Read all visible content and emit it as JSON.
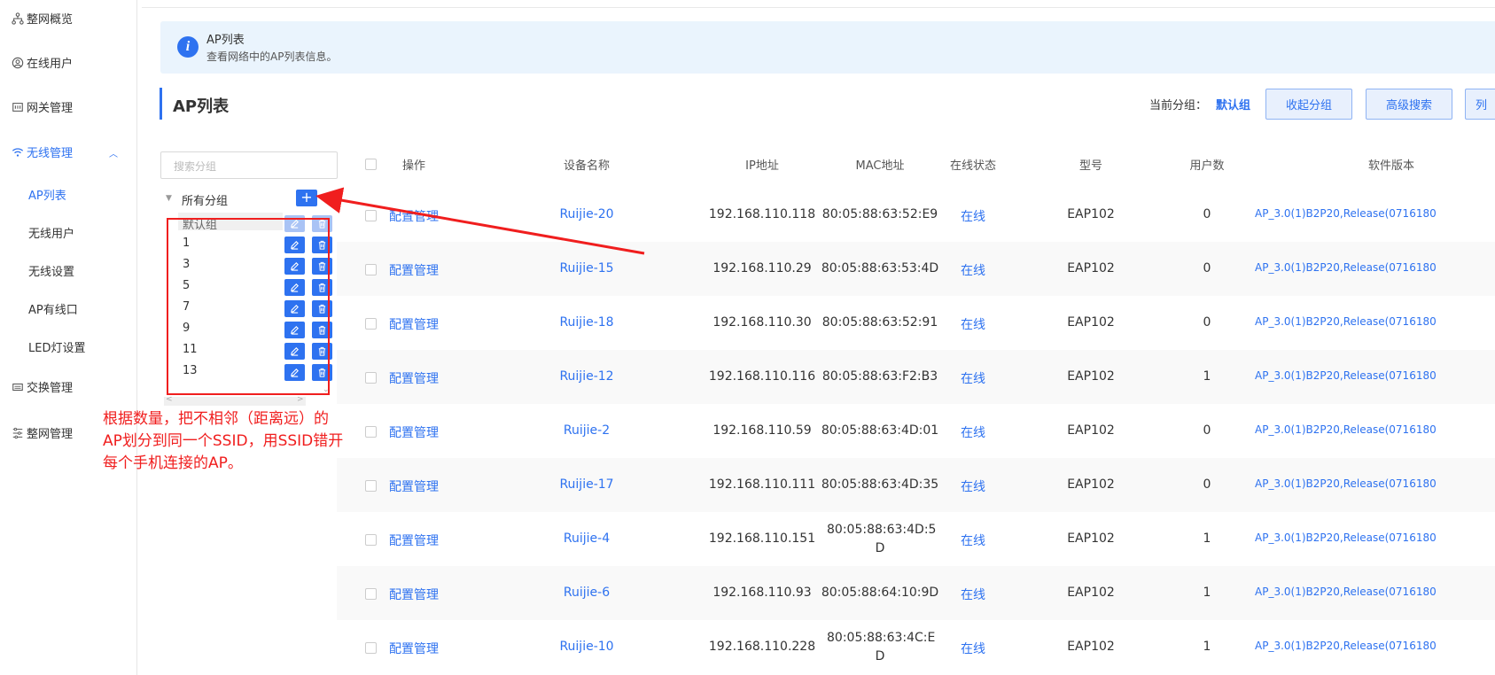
{
  "sidebar": {
    "items": [
      {
        "label": "整网概览",
        "icon": "topology-icon"
      },
      {
        "label": "在线用户",
        "icon": "user-circle-icon"
      },
      {
        "label": "网关管理",
        "icon": "gateway-icon"
      },
      {
        "label": "无线管理",
        "icon": "wifi-icon"
      },
      {
        "label": "交换管理",
        "icon": "switch-icon"
      },
      {
        "label": "整网管理",
        "icon": "network-manage-icon"
      }
    ],
    "wireless_sub": [
      "AP列表",
      "无线用户",
      "无线设置",
      "AP有线口",
      "LED灯设置"
    ]
  },
  "banner": {
    "title": "AP列表",
    "desc": "查看网络中的AP列表信息。"
  },
  "page": {
    "title": "AP列表",
    "current_group_label": "当前分组：",
    "current_group_value": "默认组",
    "btn_collapse": "收起分组",
    "btn_advanced": "高级搜索",
    "btn_columns": "列"
  },
  "groups": {
    "search_placeholder": "搜索分组",
    "root": "所有分组",
    "add": "+",
    "items": [
      "默认组",
      "1",
      "3",
      "5",
      "7",
      "9",
      "11",
      "13"
    ]
  },
  "annotation": {
    "line1": "根据数量，把不相邻（距离远）的",
    "line2": "AP划分到同一个SSID，用SSID错开",
    "line3": "每个手机连接的AP。"
  },
  "table": {
    "headers": {
      "op": "操作",
      "name": "设备名称",
      "ip": "IP地址",
      "mac": "MAC地址",
      "status": "在线状态",
      "model": "型号",
      "users": "用户数",
      "software": "软件版本"
    },
    "rows": [
      {
        "op": "配置管理",
        "name": "Ruijie-20",
        "ip": "192.168.110.118",
        "mac": "80:05:88:63:52:E9",
        "status": "在线",
        "model": "EAP102",
        "users": "0",
        "software": "AP_3.0(1)B2P20,Release(0716180"
      },
      {
        "op": "配置管理",
        "name": "Ruijie-15",
        "ip": "192.168.110.29",
        "mac": "80:05:88:63:53:4D",
        "status": "在线",
        "model": "EAP102",
        "users": "0",
        "software": "AP_3.0(1)B2P20,Release(0716180"
      },
      {
        "op": "配置管理",
        "name": "Ruijie-18",
        "ip": "192.168.110.30",
        "mac": "80:05:88:63:52:91",
        "status": "在线",
        "model": "EAP102",
        "users": "0",
        "software": "AP_3.0(1)B2P20,Release(0716180"
      },
      {
        "op": "配置管理",
        "name": "Ruijie-12",
        "ip": "192.168.110.116",
        "mac": "80:05:88:63:F2:B3",
        "status": "在线",
        "model": "EAP102",
        "users": "1",
        "software": "AP_3.0(1)B2P20,Release(0716180"
      },
      {
        "op": "配置管理",
        "name": "Ruijie-2",
        "ip": "192.168.110.59",
        "mac": "80:05:88:63:4D:01",
        "status": "在线",
        "model": "EAP102",
        "users": "0",
        "software": "AP_3.0(1)B2P20,Release(0716180"
      },
      {
        "op": "配置管理",
        "name": "Ruijie-17",
        "ip": "192.168.110.111",
        "mac": "80:05:88:63:4D:35",
        "status": "在线",
        "model": "EAP102",
        "users": "0",
        "software": "AP_3.0(1)B2P20,Release(0716180"
      },
      {
        "op": "配置管理",
        "name": "Ruijie-4",
        "ip": "192.168.110.151",
        "mac_line1": "80:05:88:63:4D:5",
        "mac_line2": "D",
        "status": "在线",
        "model": "EAP102",
        "users": "1",
        "software": "AP_3.0(1)B2P20,Release(0716180"
      },
      {
        "op": "配置管理",
        "name": "Ruijie-6",
        "ip": "192.168.110.93",
        "mac": "80:05:88:64:10:9D",
        "status": "在线",
        "model": "EAP102",
        "users": "1",
        "software": "AP_3.0(1)B2P20,Release(0716180"
      },
      {
        "op": "配置管理",
        "name": "Ruijie-10",
        "ip": "192.168.110.228",
        "mac_line1": "80:05:88:63:4C:E",
        "mac_line2": "D",
        "status": "在线",
        "model": "EAP102",
        "users": "1",
        "software": "AP_3.0(1)B2P20,Release(0716180"
      }
    ]
  },
  "colors": {
    "accent": "#2e72f0",
    "annotation": "#f01e1e",
    "banner_bg": "#eaf4fd"
  }
}
